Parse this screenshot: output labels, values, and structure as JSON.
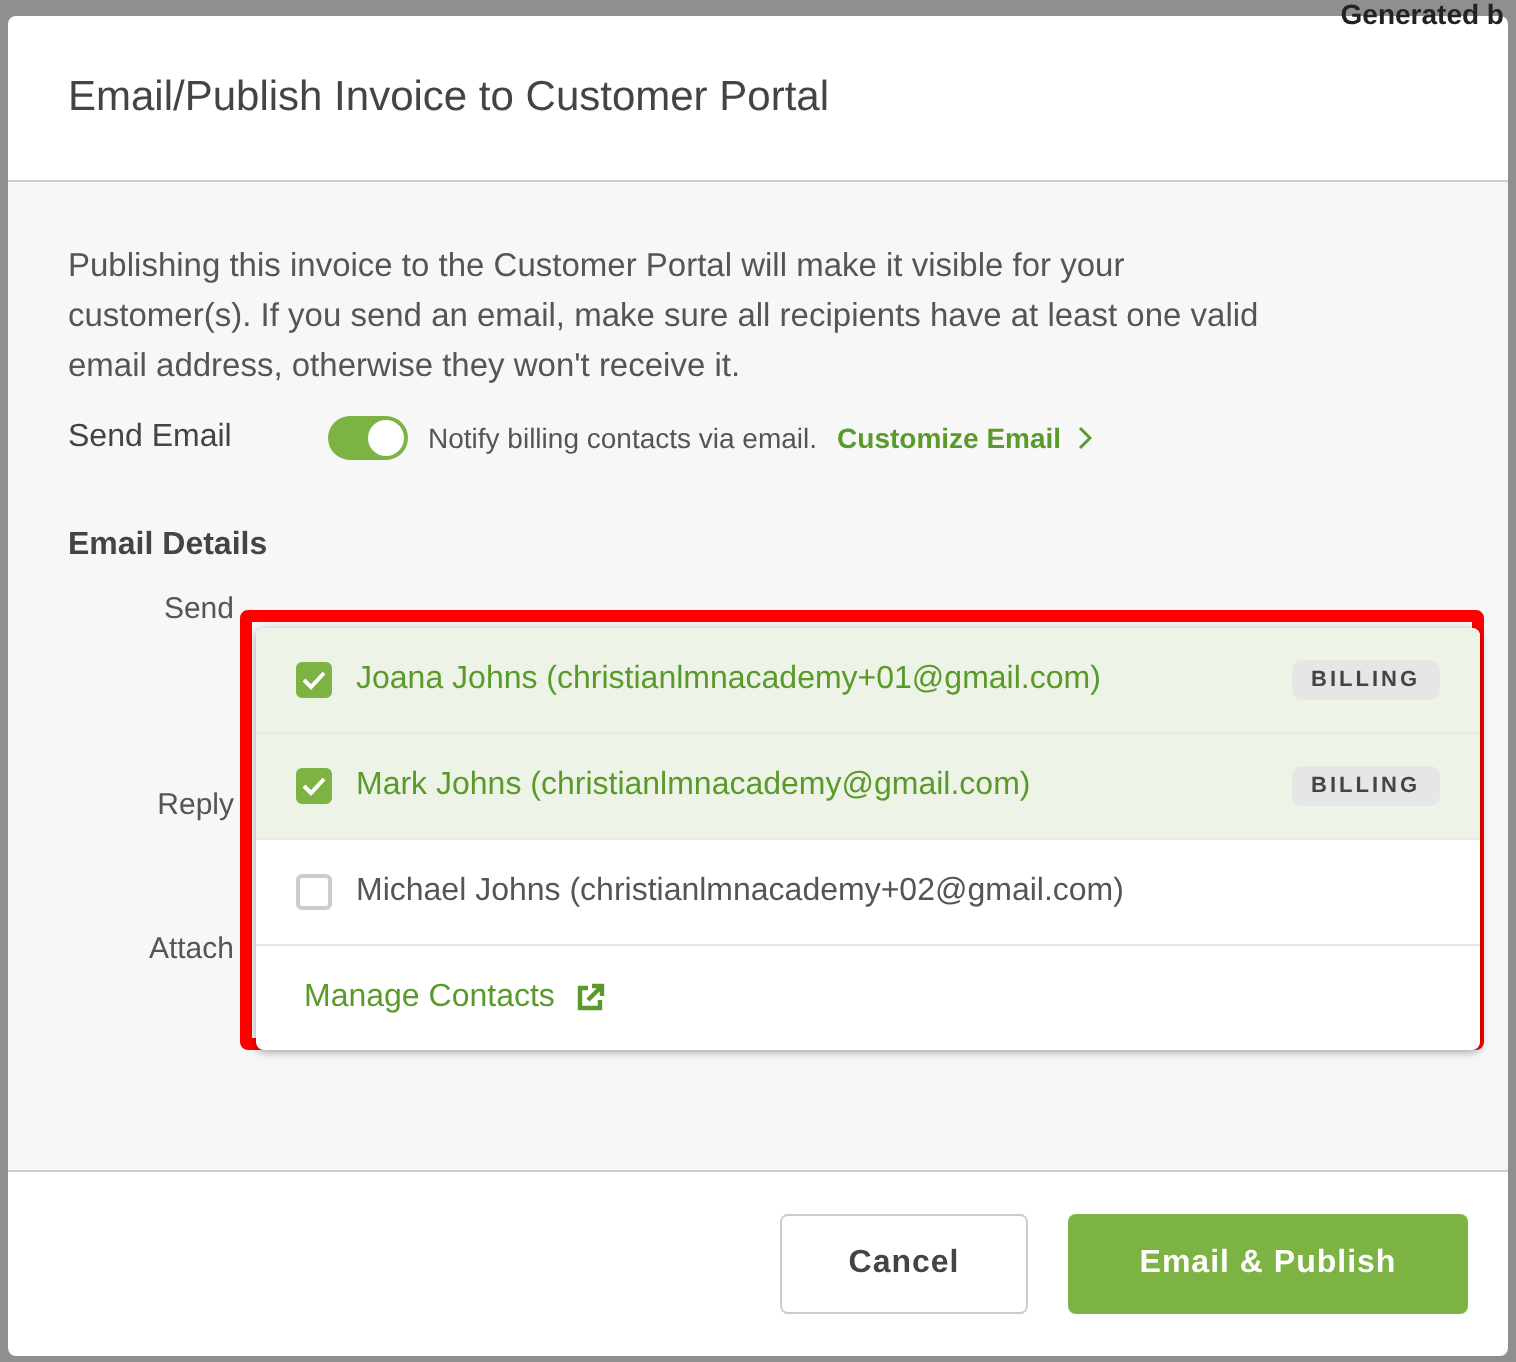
{
  "backdrop": {
    "text": "Generated b"
  },
  "dialog": {
    "title": "Email/Publish Invoice to Customer Portal",
    "intro": "Publishing this invoice to the Customer Portal will make it visible for your customer(s). If you send an email, make sure all recipients have at least one valid email address, otherwise they won't receive it.",
    "send_email": {
      "label": "Send Email",
      "on": true,
      "description": "Notify billing contacts via email.",
      "link": "Customize Email"
    },
    "section_title": "Email Details",
    "field_labels": [
      "Send",
      "Reply",
      "Attach"
    ],
    "contacts_dropdown": {
      "highlighted": true,
      "items": [
        {
          "label": "Joana Johns (christianlmnacademy+01@gmail.com)",
          "checked": true,
          "badge": "BILLING"
        },
        {
          "label": "Mark Johns (christianlmnacademy@gmail.com)",
          "checked": true,
          "badge": "BILLING"
        },
        {
          "label": "Michael Johns (christianlmnacademy+02@gmail.com)",
          "checked": false
        }
      ],
      "manage_link": "Manage Contacts"
    },
    "buttons": [
      {
        "label": "Cancel",
        "kind": "secondary"
      },
      {
        "label": "Email & Publish",
        "kind": "primary"
      }
    ]
  }
}
